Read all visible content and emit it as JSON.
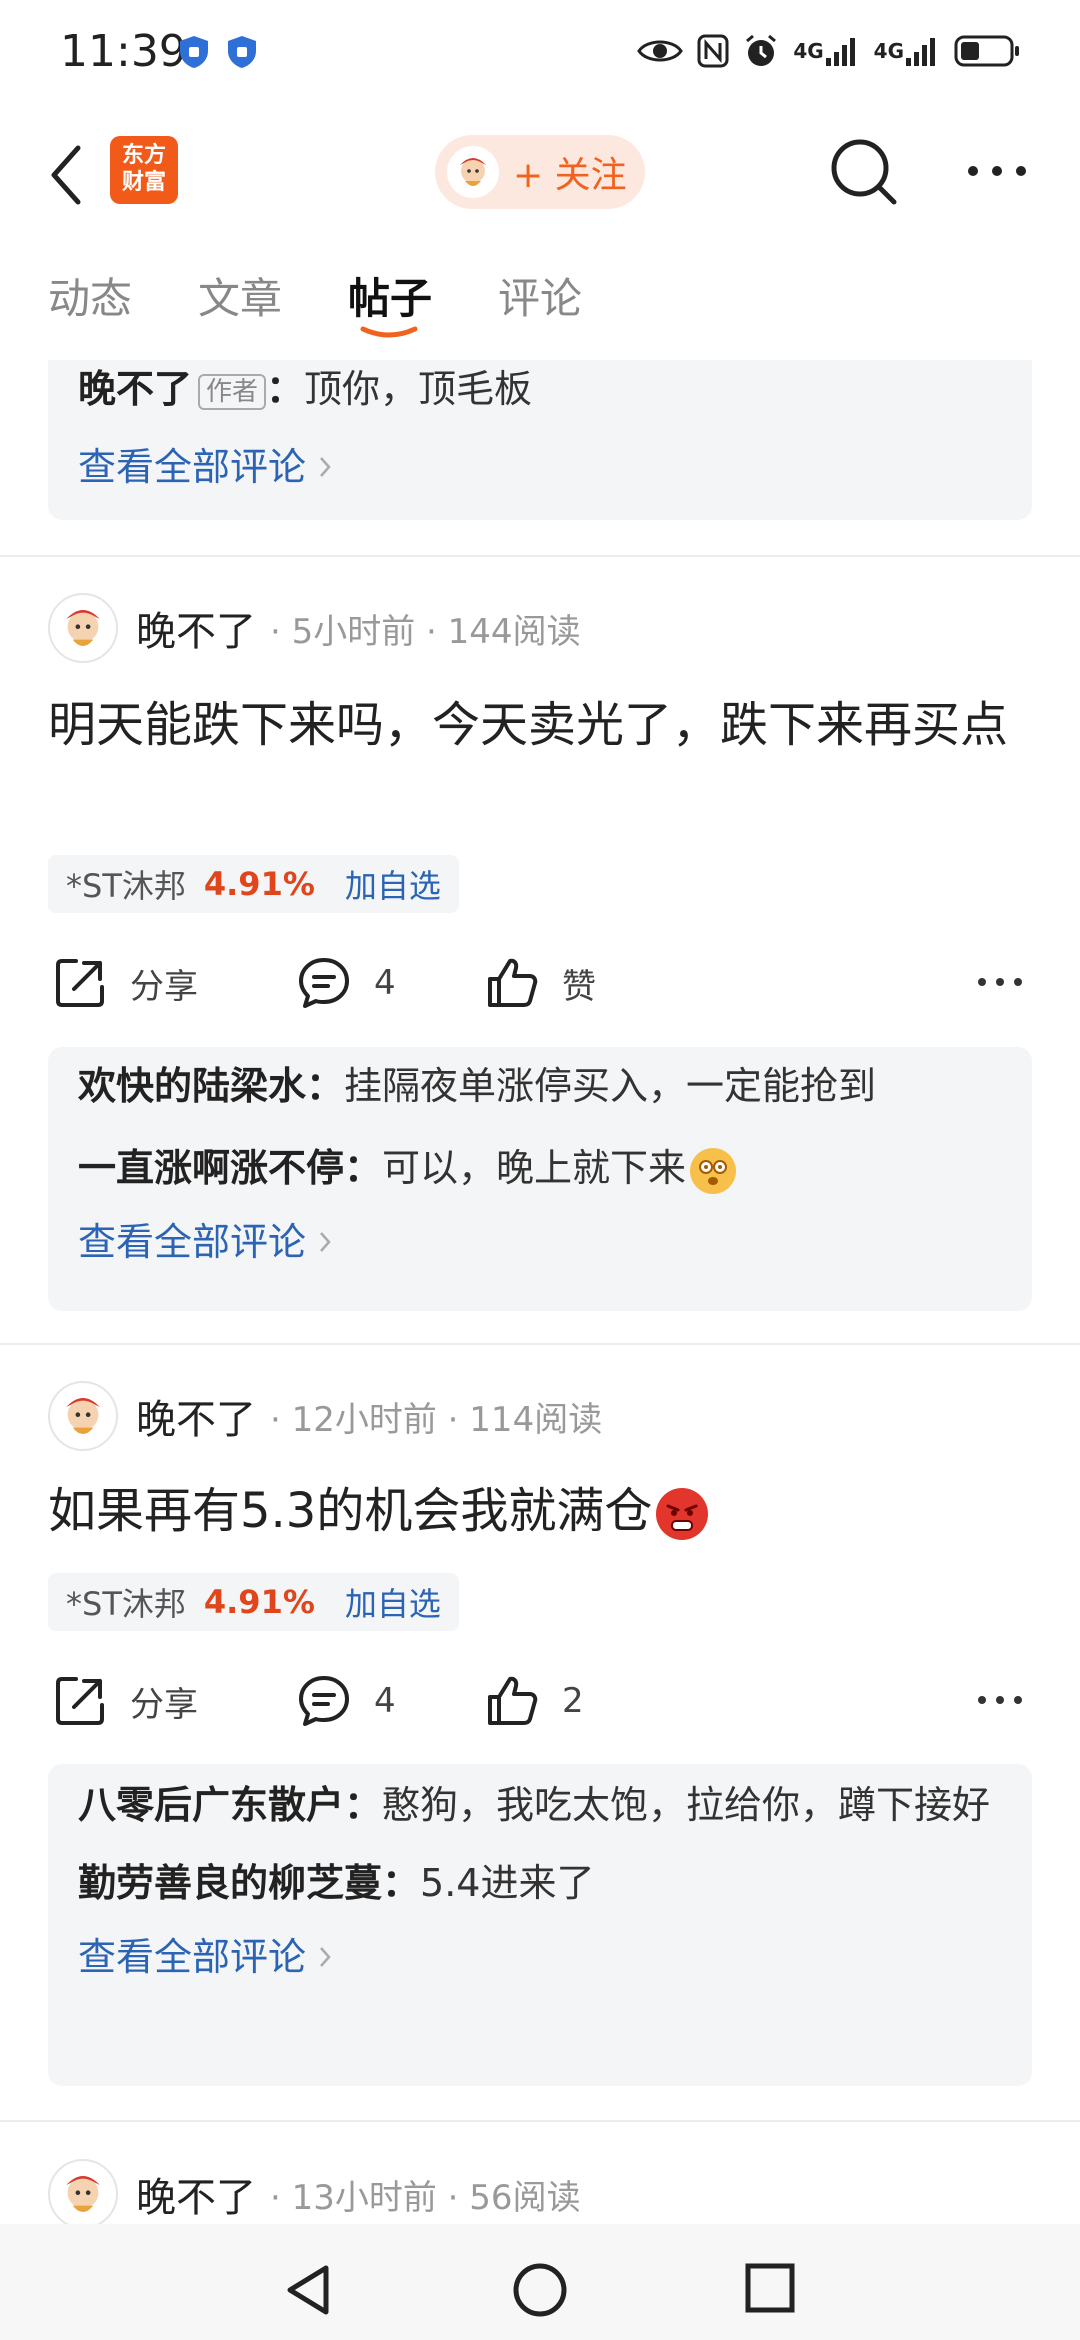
{
  "status": {
    "time": "11:39",
    "net1": "4G",
    "net2": "4G"
  },
  "header": {
    "logo_line1": "东方",
    "logo_line2": "财富",
    "follow_label": "+ 关注"
  },
  "tabs": [
    {
      "label": "动态"
    },
    {
      "label": "文章"
    },
    {
      "label": "帖子",
      "active": true
    },
    {
      "label": "评论"
    }
  ],
  "top_partial": {
    "comment_name": "晚不了",
    "author_tag": "作者",
    "comment_sep": "：",
    "comment_text": "顶你，顶毛板",
    "view_all": "查看全部评论"
  },
  "posts": [
    {
      "user": "晚不了",
      "meta": "· 5小时前 · 144阅读",
      "text": "明天能跌下来吗，今天卖光了，跌下来再买点",
      "stock": {
        "name": "*ST沐邦",
        "pct": "4.91%",
        "add": "加自选"
      },
      "share": "分享",
      "comments": "4",
      "likes": "赞",
      "replies": [
        {
          "name": "欢快的陆梁水",
          "sep": "：",
          "text": "挂隔夜单涨停买入，一定能抢到"
        },
        {
          "name": "一直涨啊涨不停",
          "sep": "：",
          "text": "可以，晚上就下来"
        }
      ],
      "view_all": "查看全部评论"
    },
    {
      "user": "晚不了",
      "meta": "· 12小时前 · 114阅读",
      "text": "如果再有5.3的机会我就满仓",
      "stock": {
        "name": "*ST沐邦",
        "pct": "4.91%",
        "add": "加自选"
      },
      "share": "分享",
      "comments": "4",
      "likes": "2",
      "replies": [
        {
          "name": "八零后广东散户",
          "sep": "：",
          "text": "憨狗，我吃太饱，拉给你，蹲下接好"
        },
        {
          "name": "勤劳善良的柳芝蔓",
          "sep": "：",
          "text": "5.4进来了"
        }
      ],
      "view_all": "查看全部评论"
    },
    {
      "user": "晚不了",
      "meta": "· 13小时前 · 56阅读"
    }
  ],
  "colors": {
    "accent": "#f2621f",
    "link": "#2b64b4",
    "rise": "#e0451b"
  }
}
